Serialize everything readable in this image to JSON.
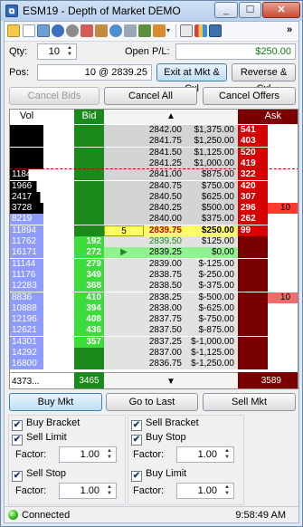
{
  "window": {
    "title": "ESM19 - Depth of Market DEMO",
    "minimize_glyph": "_",
    "maximize_glyph": "☐",
    "close_glyph": "✕"
  },
  "toolbar": {
    "icons": [
      "edit-icon",
      "document-icon",
      "grid-icon",
      "circle-icon",
      "gear-icon",
      "flask-icon",
      "tag-icon",
      "globe-icon",
      "filter-icon",
      "chart-icon",
      "paint-icon",
      "ticket-icon",
      "color-bars-icon",
      "chart-window-icon"
    ],
    "overflow": "»",
    "dropdown_glyph": "▾"
  },
  "form": {
    "qty_label": "Qty:",
    "qty_value": "10",
    "open_pl_label": "Open P/L:",
    "open_pl_value": "$250.00",
    "pos_label": "Pos:",
    "pos_value": "10 @ 2839.25",
    "exit_button": "Exit at Mkt & Cxl",
    "reverse_button": "Reverse & Cxl"
  },
  "actions": {
    "cancel_bids": "Cancel Bids",
    "cancel_all": "Cancel All",
    "cancel_offers": "Cancel Offers"
  },
  "ladder": {
    "headers": {
      "vol": "Vol",
      "bid": "Bid",
      "ask": "Ask"
    },
    "scroll_up": "▲",
    "scroll_down": "▼",
    "rows": [
      {
        "vol": "",
        "vol_pct": 1.0,
        "vol_black": true,
        "bid": "",
        "mark": "",
        "price": "2842.00",
        "pl": "$1,375.00",
        "ask": "541",
        "ask_order": ""
      },
      {
        "vol": "",
        "vol_pct": 1.0,
        "vol_black": true,
        "bid": "",
        "mark": "",
        "price": "2841.75",
        "pl": "$1,250.00",
        "ask": "403",
        "ask_order": ""
      },
      {
        "vol": "",
        "vol_pct": 1.0,
        "vol_black": true,
        "bid": "",
        "mark": "",
        "price": "2841.50",
        "pl": "$1,125.00",
        "ask": "520",
        "ask_order": ""
      },
      {
        "vol": "",
        "vol_pct": 1.0,
        "vol_black": true,
        "bid": "",
        "mark": "",
        "price": "2841.25",
        "pl": "$1,000.00",
        "ask": "419",
        "ask_order": ""
      },
      {
        "vol": "1184",
        "vol_pct": 0.55,
        "vol_black": true,
        "bid": "",
        "mark": "",
        "price": "2841.00",
        "pl": "$875.00",
        "ask": "322",
        "ask_order": ""
      },
      {
        "vol": "1966",
        "vol_pct": 0.8,
        "vol_black": true,
        "bid": "",
        "mark": "",
        "price": "2840.75",
        "pl": "$750.00",
        "ask": "420",
        "ask_order": ""
      },
      {
        "vol": "2417",
        "vol_pct": 0.9,
        "vol_black": true,
        "bid": "",
        "mark": "",
        "price": "2840.50",
        "pl": "$625.00",
        "ask": "307",
        "ask_order": ""
      },
      {
        "vol": "3728",
        "vol_pct": 1.0,
        "vol_black": true,
        "bid": "",
        "mark": "",
        "price": "2840.25",
        "pl": "$500.00",
        "ask": "296",
        "ask_order": "10"
      },
      {
        "vol": "8219",
        "vol_pct": 1.0,
        "vol_black": false,
        "bid": "",
        "mark": "",
        "price": "2840.00",
        "pl": "$375.00",
        "ask": "262",
        "ask_order": ""
      },
      {
        "vol": "11894",
        "vol_pct": 1.0,
        "vol_black": false,
        "bid": "",
        "mark": "5",
        "price": "2839.75",
        "pl": "$250.00",
        "ask": "99",
        "ask_order": "",
        "last": true
      },
      {
        "vol": "11762",
        "vol_pct": 1.0,
        "vol_black": false,
        "bid": "192",
        "mark": "",
        "price": "2839.50",
        "pl": "$125.00",
        "ask": "",
        "ask_order": ""
      },
      {
        "vol": "16171",
        "vol_pct": 1.0,
        "vol_black": false,
        "bid": "272",
        "mark": "▶",
        "price": "2839.25",
        "pl": "$0.00",
        "ask": "",
        "ask_order": "",
        "entry": true
      },
      {
        "vol": "11144",
        "vol_pct": 1.0,
        "vol_black": false,
        "bid": "279",
        "mark": "",
        "price": "2839.00",
        "pl": "$-125.00",
        "ask": "",
        "ask_order": ""
      },
      {
        "vol": "11176",
        "vol_pct": 1.0,
        "vol_black": false,
        "bid": "349",
        "mark": "",
        "price": "2838.75",
        "pl": "$-250.00",
        "ask": "",
        "ask_order": ""
      },
      {
        "vol": "12283",
        "vol_pct": 1.0,
        "vol_black": false,
        "bid": "368",
        "mark": "",
        "price": "2838.50",
        "pl": "$-375.00",
        "ask": "",
        "ask_order": ""
      },
      {
        "vol": "8836",
        "vol_pct": 1.0,
        "vol_black": false,
        "bid": "410",
        "mark": "",
        "price": "2838.25",
        "pl": "$-500.00",
        "ask": "",
        "ask_order": "10"
      },
      {
        "vol": "10888",
        "vol_pct": 1.0,
        "vol_black": false,
        "bid": "394",
        "mark": "",
        "price": "2838.00",
        "pl": "$-625.00",
        "ask": "",
        "ask_order": ""
      },
      {
        "vol": "12196",
        "vol_pct": 1.0,
        "vol_black": false,
        "bid": "408",
        "mark": "",
        "price": "2837.75",
        "pl": "$-750.00",
        "ask": "",
        "ask_order": ""
      },
      {
        "vol": "12621",
        "vol_pct": 1.0,
        "vol_black": false,
        "bid": "436",
        "mark": "",
        "price": "2837.50",
        "pl": "$-875.00",
        "ask": "",
        "ask_order": ""
      },
      {
        "vol": "14301",
        "vol_pct": 1.0,
        "vol_black": false,
        "bid": "357",
        "mark": "",
        "price": "2837.25",
        "pl": "$-1,000.00",
        "ask": "",
        "ask_order": ""
      },
      {
        "vol": "14292",
        "vol_pct": 1.0,
        "vol_black": false,
        "bid": "",
        "mark": "",
        "price": "2837.00",
        "pl": "$-1,125.00",
        "ask": "",
        "ask_order": ""
      },
      {
        "vol": "16800",
        "vol_pct": 1.0,
        "vol_black": false,
        "bid": "",
        "mark": "",
        "price": "2836.75",
        "pl": "$-1,250.00",
        "ask": "",
        "ask_order": ""
      }
    ],
    "footer": {
      "vol_total": "4373...",
      "bid_total": "3465",
      "ask_total": "3589"
    }
  },
  "bottom_buttons": {
    "buy_mkt": "Buy Mkt",
    "go_to_last": "Go to Last",
    "sell_mkt": "Sell Mkt"
  },
  "brackets": {
    "buy_bracket": "Buy Bracket",
    "sell_bracket": "Sell Bracket",
    "sell_limit": "Sell Limit",
    "buy_stop": "Buy Stop",
    "factor_label": "Factor:",
    "factor_1": "1.00",
    "factor_2": "1.00",
    "sell_stop": "Sell Stop",
    "buy_limit": "Buy Limit",
    "factor_3": "1.00",
    "factor_4": "1.00",
    "check": "✔"
  },
  "status": {
    "connection": "Connected",
    "time": "9:58:49 AM"
  },
  "colors": {
    "bid": "#1a8a1a",
    "bid_cell": "#3ddc3d",
    "ask": "#7a0000",
    "ask_cell": "#d60000",
    "last": "#ffff66",
    "vol_bar": "#8f9cff"
  }
}
